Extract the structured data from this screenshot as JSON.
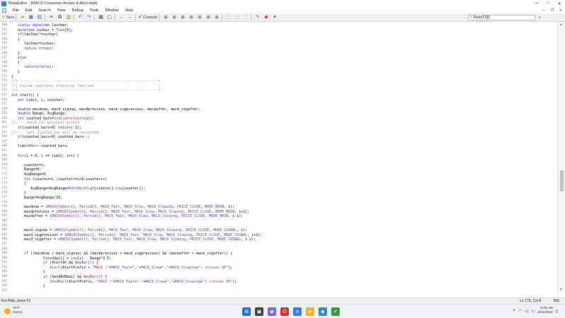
{
  "window": {
    "title": "MetaEditor - [MACD Crossover Arrows & Alert.mq4]",
    "controls": [
      "—",
      "□",
      "✕"
    ]
  },
  "menu": {
    "items": [
      "File",
      "Edit",
      "Search",
      "View",
      "Debug",
      "Tools",
      "Window",
      "Help"
    ],
    "mdi_controls": [
      "—",
      "❐",
      "✕"
    ]
  },
  "toolbar": {
    "new_label": "New",
    "compile_label": "Compile",
    "search_value": "ForexTSD"
  },
  "code_lines": [
    {
      "n": "140",
      "t": "   static datetime lastbar;"
    },
    {
      "n": "141",
      "t": "   datetime curbar = Time[0];"
    },
    {
      "n": "142",
      "t": "   if(lastbar!=curbar)"
    },
    {
      "n": "143",
      "t": "   {"
    },
    {
      "n": "144",
      "t": "      lastbar=curbar;"
    },
    {
      "n": "145",
      "t": "      return (true);"
    },
    {
      "n": "146",
      "t": "   }"
    },
    {
      "n": "147",
      "t": "   else"
    },
    {
      "n": "148",
      "t": "   {"
    },
    {
      "n": "149",
      "t": "      return(false);"
    },
    {
      "n": "150",
      "t": "   }"
    },
    {
      "n": "151",
      "t": "}"
    },
    {
      "n": "152",
      "t": "//+------------------------------------------------------------------+"
    },
    {
      "n": "153",
      "t": "//| Custom indicator iteration function                              |"
    },
    {
      "n": "154",
      "t": "//+------------------------------------------------------------------+"
    },
    {
      "n": "155",
      "t": "int start() {"
    },
    {
      "n": "156",
      "t": "   int limit, i, counter;"
    },
    {
      "n": "157",
      "t": ""
    },
    {
      "n": "158",
      "t": "   double macdnow, macd_signow, macdprevious, macd_sigprevious, macdafter, macd_sigafter;"
    },
    {
      "n": "159",
      "t": "   double Range, AvgRange;"
    },
    {
      "n": "160",
      "t": "   int counted_bars=IndicatorCounted();"
    },
    {
      "n": "161",
      "t": "//---- check for possible errors"
    },
    {
      "n": "162",
      "t": "   if(counted_bars<0) return(-1);"
    },
    {
      "n": "163",
      "t": "//---- last counted bar will be recounted"
    },
    {
      "n": "164",
      "t": "   if(counted_bars>0) counted_bars--;"
    },
    {
      "n": "165",
      "t": ""
    },
    {
      "n": "166",
      "t": "   limit=Bars-counted_bars;"
    },
    {
      "n": "167",
      "t": ""
    },
    {
      "n": "168",
      "t": "   for(i = 0; i <= limit; i++) {"
    },
    {
      "n": "169",
      "t": ""
    },
    {
      "n": "170",
      "t": "      counter=i;"
    },
    {
      "n": "171",
      "t": "      Range=0;"
    },
    {
      "n": "172",
      "t": "      AvgRange=0;"
    },
    {
      "n": "173",
      "t": "      for (counter=i ;counter<=i+9;counter++)"
    },
    {
      "n": "174",
      "t": "      {"
    },
    {
      "n": "175",
      "t": "         AvgRange=AvgRange+MathAbs(High[counter]-Low[counter]);"
    },
    {
      "n": "176",
      "t": "      }"
    },
    {
      "n": "177",
      "t": "      Range=AvgRange/10;"
    },
    {
      "n": "178",
      "t": ""
    },
    {
      "n": "179",
      "t": "      macdnow = iMACD(Symbol(), Period(), MACD_Fast, MACD_Slow, MACD_Slowing, PRICE_CLOSE, MODE_MAIN, i);"
    },
    {
      "n": "180",
      "t": "      macdprevious = iMACD(Symbol(), Period(), MACD_Fast, MACD_Slow, MACD_Slowing, PRICE_CLOSE, MODE_MAIN, i+1);"
    },
    {
      "n": "181",
      "t": "      macdafter = iMACD(Symbol(), Period(), MACD_Fast, MACD_Slow, MACD_Slowing, PRICE_CLOSE, MODE_MAIN, i-1);"
    },
    {
      "n": "182",
      "t": ""
    },
    {
      "n": "183",
      "t": ""
    },
    {
      "n": "184",
      "t": "      macd_signow = iMACD(Symbol(), Period(), MACD_Fast, MACD_Slow, MACD_Slowing, PRICE_CLOSE, MODE_SIGNAL, i);"
    },
    {
      "n": "185",
      "t": "      macd_sigprevious = iMACD(Symbol(), Period(), MACD_Fast, MACD_Slow, MACD_Slowing, PRICE_CLOSE, MODE_SIGNAL, i+1);"
    },
    {
      "n": "186",
      "t": "      macd_sigafter = iMACD(Symbol(), Period(), MACD_Fast, MACD_Slow, MACD_Slowing, PRICE_CLOSE, MODE_SIGNAL, i-1);"
    },
    {
      "n": "187",
      "t": ""
    },
    {
      "n": "188",
      "t": ""
    },
    {
      "n": "189",
      "t": "      if ((macdnow > macd_signow) && (macdprevious < macd_sigprevious) && (macdafter > macd_sigafter)) {"
    },
    {
      "n": "190",
      "t": "               CrossUp[i] = Low[i] - Range*1.5;"
    },
    {
      "n": "191",
      "t": "               if (AlertOn && NewBar()) {"
    },
    {
      "n": "192",
      "t": "                  Alert(AlertPrefix + \"MACD (\"+MACD_Fast+\",\"+MACD_Slow+\",\"+MACD_Slowing+\") crosses UP\");"
    },
    {
      "n": "193",
      "t": "               }"
    },
    {
      "n": "194",
      "t": "               if (SendAnEmail && NewBar()) {"
    },
    {
      "n": "195",
      "t": "                  SendMail(AlertPrefix, \"MACD (\"+MACD_Fast+\",\"+MACD_Slow+\",\"+MACD_Slowing+\") crosses UP\");"
    },
    {
      "n": "196",
      "t": "               }"
    },
    {
      "n": "197",
      "t": ""
    }
  ],
  "status": {
    "help": "For Help, press F1",
    "position": "Ln 176, Col 8",
    "mode": "INS"
  },
  "taskbar": {
    "temperature": "70°F",
    "condition": "Sunny",
    "time": "9:45 AM",
    "date": "8/21/2022"
  }
}
